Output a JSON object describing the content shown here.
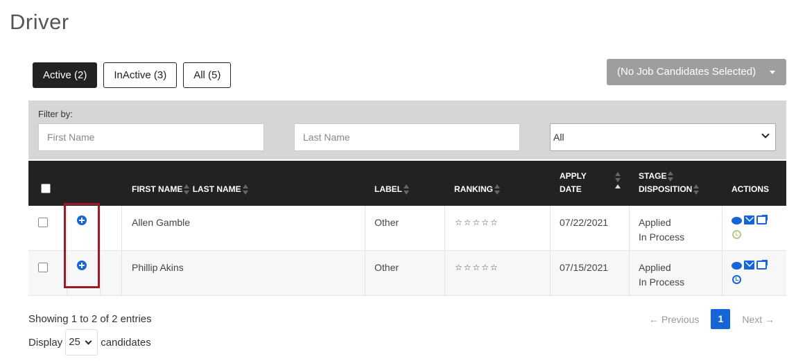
{
  "page_title": "Driver",
  "tabs": [
    {
      "label": "Active (2)",
      "active": true
    },
    {
      "label": "InActive (3)",
      "active": false
    },
    {
      "label": "All (5)",
      "active": false
    }
  ],
  "job_dropdown": {
    "label": "(No Job Candidates Selected)"
  },
  "filter": {
    "label": "Filter by:",
    "first_name_placeholder": "First Name",
    "last_name_placeholder": "Last Name",
    "status_selected": "All"
  },
  "table": {
    "headers": {
      "first_name": "FIRST NAME",
      "last_name": "LAST NAME",
      "label": "LABEL",
      "ranking": "RANKING",
      "apply_date_1": "APPLY",
      "apply_date_2": "DATE",
      "stage_1": "STAGE",
      "stage_2": "DISPOSITION",
      "actions": "ACTIONS"
    },
    "rows": [
      {
        "name": "Allen Gamble",
        "label": "Other",
        "ranking": "☆☆☆☆☆",
        "apply_date": "07/22/2021",
        "stage": "Applied",
        "disposition": "In Process",
        "clock_color": "#b5c98b"
      },
      {
        "name": "Phillip Akins",
        "label": "Other",
        "ranking": "☆☆☆☆☆",
        "apply_date": "07/15/2021",
        "stage": "Applied",
        "disposition": "In Process",
        "clock_color": "#1565d8"
      }
    ]
  },
  "footer": {
    "showing": "Showing 1 to 2 of 2 entries",
    "display_prefix": "Display",
    "display_value": "25",
    "display_suffix": "candidates",
    "previous": "← Previous",
    "current_page": "1",
    "next": "Next →"
  },
  "colors": {
    "accent": "#1565d8",
    "header_bg": "#222222",
    "highlight": "#9b1b24"
  }
}
